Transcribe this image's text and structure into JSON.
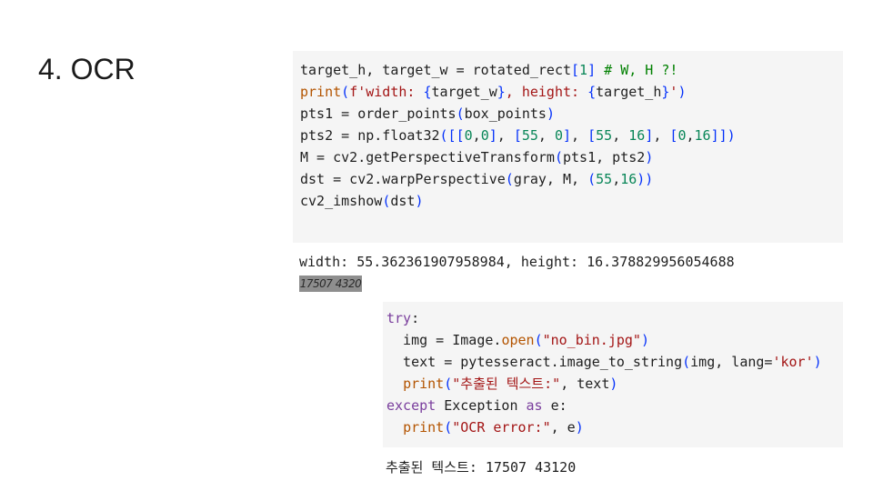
{
  "slide": {
    "title": "4. OCR"
  },
  "cell1": {
    "lines": [
      [
        [
          "",
          "target_h, target_w = rotated_rect"
        ],
        [
          "br",
          "["
        ],
        [
          "num",
          "1"
        ],
        [
          "br",
          "]"
        ],
        [
          "",
          " "
        ],
        [
          "cm",
          "# W, H ?!"
        ]
      ],
      [
        [
          "fn",
          "print"
        ],
        [
          "br",
          "("
        ],
        [
          "str",
          "f'width: "
        ],
        [
          "br",
          "{"
        ],
        [
          "",
          "target_w"
        ],
        [
          "br",
          "}"
        ],
        [
          "str",
          ", height: "
        ],
        [
          "br",
          "{"
        ],
        [
          "",
          "target_h"
        ],
        [
          "br",
          "}"
        ],
        [
          "str",
          "'"
        ],
        [
          "br",
          ")"
        ]
      ],
      [
        [
          "",
          "pts1 = order_points"
        ],
        [
          "br",
          "("
        ],
        [
          "",
          "box_points"
        ],
        [
          "br",
          ")"
        ]
      ],
      [
        [
          "",
          "pts2 = np.float32"
        ],
        [
          "br",
          "([["
        ],
        [
          "num",
          "0"
        ],
        [
          "",
          ","
        ],
        [
          "num",
          "0"
        ],
        [
          "br",
          "]"
        ],
        [
          "",
          ", "
        ],
        [
          "br",
          "["
        ],
        [
          "num",
          "55"
        ],
        [
          "",
          ", "
        ],
        [
          "num",
          "0"
        ],
        [
          "br",
          "]"
        ],
        [
          "",
          ", "
        ],
        [
          "br",
          "["
        ],
        [
          "num",
          "55"
        ],
        [
          "",
          ", "
        ],
        [
          "num",
          "16"
        ],
        [
          "br",
          "]"
        ],
        [
          "",
          ", "
        ],
        [
          "br",
          "["
        ],
        [
          "num",
          "0"
        ],
        [
          "",
          ","
        ],
        [
          "num",
          "16"
        ],
        [
          "br",
          "]])"
        ]
      ],
      [
        [
          "",
          "M = cv2.getPerspectiveTransform"
        ],
        [
          "br",
          "("
        ],
        [
          "",
          "pts1, pts2"
        ],
        [
          "br",
          ")"
        ]
      ],
      [
        [
          "",
          "dst = cv2.warpPerspective"
        ],
        [
          "br",
          "("
        ],
        [
          "",
          "gray, M, "
        ],
        [
          "br",
          "("
        ],
        [
          "num",
          "55"
        ],
        [
          "",
          ","
        ],
        [
          "num",
          "16"
        ],
        [
          "br",
          "))"
        ]
      ],
      [
        [
          "",
          "cv2_imshow"
        ],
        [
          "br",
          "("
        ],
        [
          "",
          "dst"
        ],
        [
          "br",
          ")"
        ]
      ]
    ]
  },
  "output1": {
    "text": "width: 55.362361907958984, height: 16.378829956054688"
  },
  "ocr_image": {
    "text": "17507 4320"
  },
  "cell2": {
    "lines": [
      [
        [
          "kw",
          "try"
        ],
        [
          "",
          ":"
        ]
      ],
      [
        [
          "",
          "  img = Image."
        ],
        [
          "fn",
          "open"
        ],
        [
          "br",
          "("
        ],
        [
          "str",
          "\"no_bin.jpg\""
        ],
        [
          "br",
          ")"
        ]
      ],
      [
        [
          "",
          "  text = pytesseract.image_to_string"
        ],
        [
          "br",
          "("
        ],
        [
          "",
          "img, lang="
        ],
        [
          "str",
          "'kor'"
        ],
        [
          "br",
          ")"
        ]
      ],
      [
        [
          "",
          "  "
        ],
        [
          "fn",
          "print"
        ],
        [
          "br",
          "("
        ],
        [
          "str",
          "\"추출된 텍스트:\""
        ],
        [
          "",
          ", text"
        ],
        [
          "br",
          ")"
        ]
      ],
      [
        [
          "kw",
          "except"
        ],
        [
          "",
          " Exception "
        ],
        [
          "kw",
          "as"
        ],
        [
          "",
          " e:"
        ]
      ],
      [
        [
          "",
          "  "
        ],
        [
          "fn",
          "print"
        ],
        [
          "br",
          "("
        ],
        [
          "str",
          "\"OCR error:\""
        ],
        [
          "",
          ", e"
        ],
        [
          "br",
          ")"
        ]
      ]
    ]
  },
  "output2": {
    "text": "추출된 텍스트: 17507 43120"
  }
}
